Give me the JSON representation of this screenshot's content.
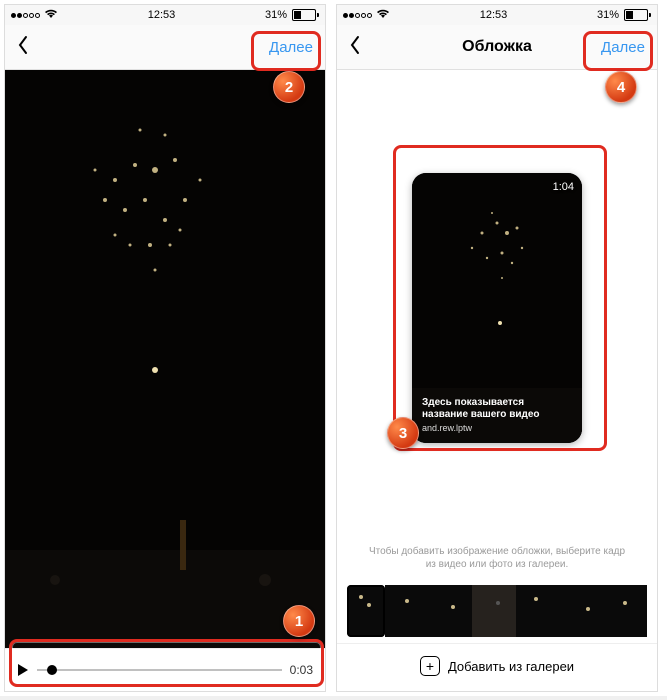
{
  "status": {
    "time": "12:53",
    "battery_pct": "31%",
    "signal_dots_filled": 2,
    "signal_dots_total": 5
  },
  "screen1": {
    "next_label": "Далее",
    "player_time": "0:03"
  },
  "screen2": {
    "title": "Обложка",
    "next_label": "Далее",
    "cover": {
      "duration": "1:04",
      "caption_title": "Здесь показывается название вашего видео",
      "author": "and.rew.lptw"
    },
    "hint": "Чтобы добавить изображение обложки, выберите кадр из видео или фото из галереи.",
    "gallery_button": "Добавить из галереи"
  },
  "annotations": {
    "b1": "1",
    "b2": "2",
    "b3": "3",
    "b4": "4"
  }
}
